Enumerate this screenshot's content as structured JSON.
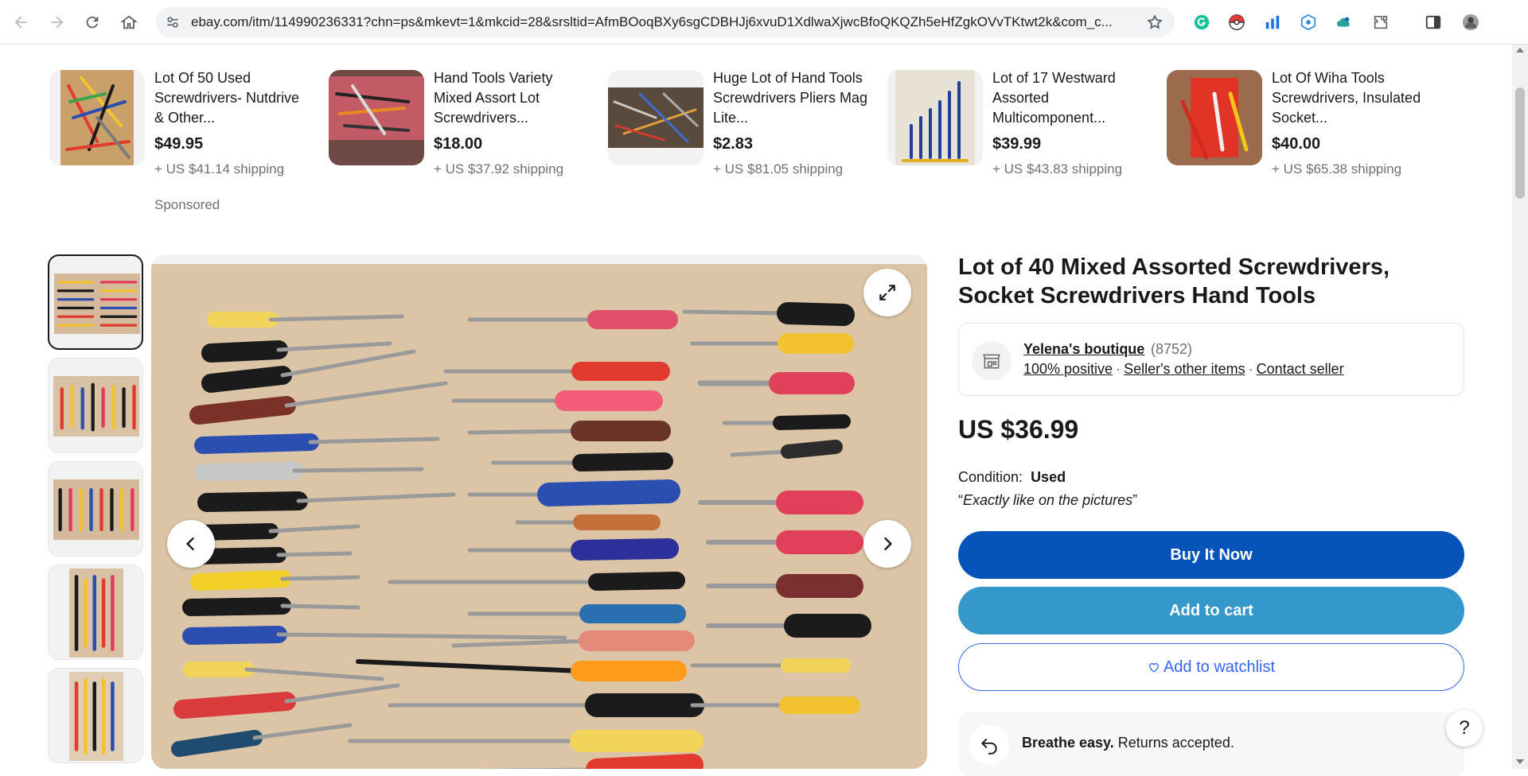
{
  "browser": {
    "url": "ebay.com/itm/114990236331?chn=ps&mkevt=1&mkcid=28&srsltid=AfmBOoqBXy6sgCDBHJj6xvuD1XdlwaXjwcBfoQKQZh5eHfZgkOVvTKtwt2k&com_c..."
  },
  "related": {
    "items": [
      {
        "title": "Lot Of 50 Used Screwdrivers- Nutdrive & Other...",
        "price": "$49.95",
        "shipping": "+ US $41.14 shipping",
        "sponsored": "Sponsored"
      },
      {
        "title": "Hand Tools Variety Mixed Assort Lot Screwdrivers...",
        "price": "$18.00",
        "shipping": "+ US $37.92 shipping"
      },
      {
        "title": "Huge Lot of Hand Tools Screwdrivers Pliers Mag Lite...",
        "price": "$2.83",
        "shipping": "+ US $81.05 shipping"
      },
      {
        "title": "Lot of 17 Westward Assorted Multicomponent...",
        "price": "$39.99",
        "shipping": "+ US $43.83 shipping"
      },
      {
        "title": "Lot Of Wiha Tools Screwdrivers, Insulated Socket...",
        "price": "$40.00",
        "shipping": "+ US $65.38 shipping"
      }
    ]
  },
  "item": {
    "title": "Lot of 40 Mixed Assorted Screwdrivers, Socket Screwdrivers Hand Tools",
    "seller_name": "Yelena's boutique",
    "seller_count": "(8752)",
    "seller_positive": "100% positive",
    "seller_other": "Seller's other items",
    "seller_contact": "Contact seller",
    "price": "US $36.99",
    "condition_label": "Condition:",
    "condition_value": "Used",
    "condition_note": "Exactly like on the pictures",
    "buy_label": "Buy It Now",
    "cart_label": "Add to cart",
    "watch_label": "Add to watchlist",
    "returns_bold": "Breathe easy.",
    "returns_text": "Returns accepted."
  },
  "help_label": "?",
  "colors": {
    "buy": "#0654ba",
    "cart": "#3498ca",
    "link": "#3665f3"
  }
}
